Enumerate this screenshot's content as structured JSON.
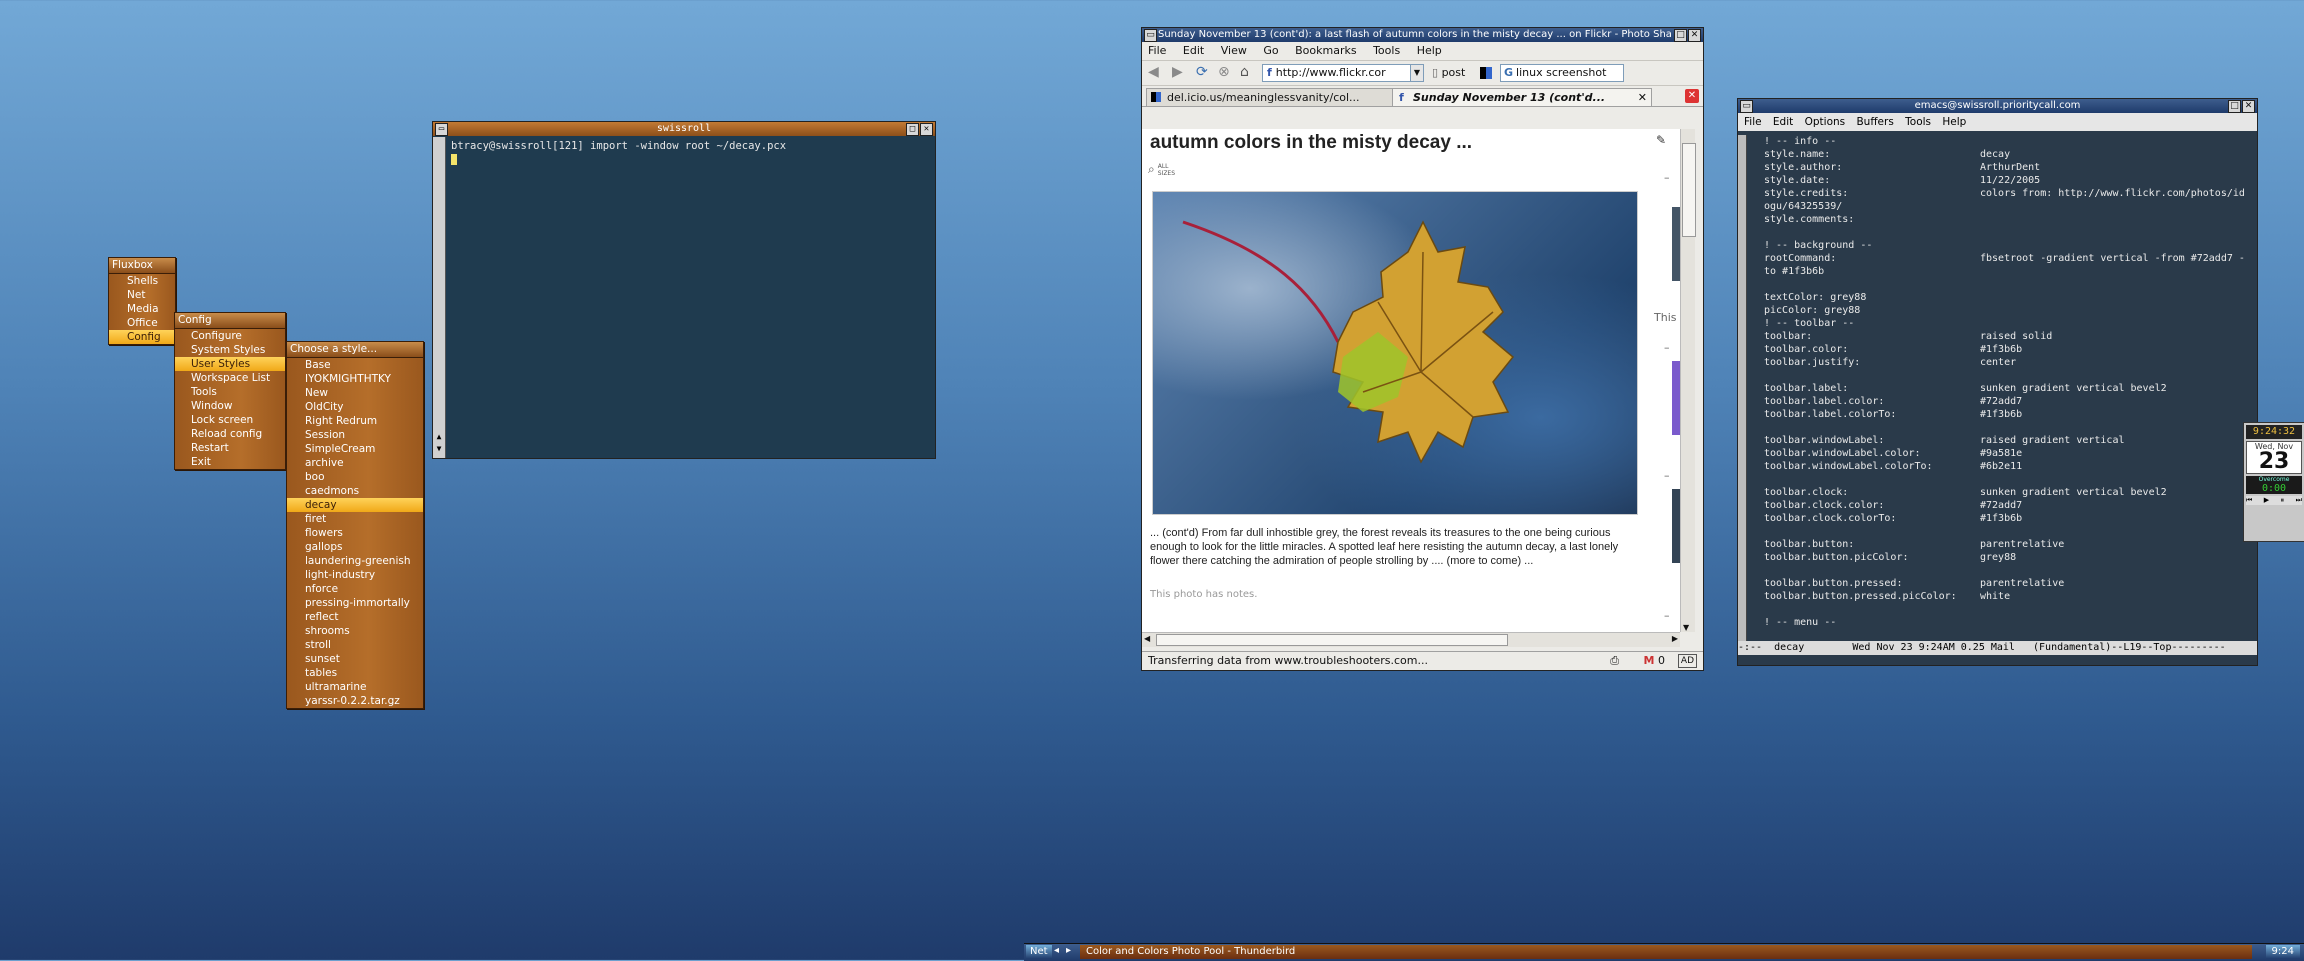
{
  "fluxbox_menu": {
    "title": "Fluxbox",
    "items": [
      "Shells",
      "Net",
      "Media",
      "Office",
      "Config"
    ]
  },
  "config_menu": {
    "title": "Config",
    "items": [
      "Configure",
      "System Styles",
      "User Styles",
      "Workspace List",
      "Tools",
      "Window",
      "Lock screen",
      "Reload config",
      "Restart",
      "Exit"
    ]
  },
  "style_menu": {
    "title": "Choose a style...",
    "items": [
      "Base",
      "IYOKMIGHTHTKY",
      "New",
      "OldCity",
      "Right Redrum",
      "Session",
      "SimpleCream",
      "archive",
      "boo",
      "caedmons",
      "decay",
      "firet",
      "flowers",
      "gallops",
      "laundering-greenish",
      "light-industry",
      "nforce",
      "pressing-immortally",
      "reflect",
      "shrooms",
      "stroll",
      "sunset",
      "tables",
      "ultramarine",
      "yarssr-0.2.2.tar.gz"
    ]
  },
  "terminal": {
    "title": "swissroll",
    "command_line": "btracy@swissroll[121] import -window root ~/decay.pcx"
  },
  "firefox": {
    "title": "Sunday November 13 (cont'd): a last flash of autumn colors in the misty decay ... on Flickr - Photo Sha",
    "menu": [
      "File",
      "Edit",
      "View",
      "Go",
      "Bookmarks",
      "Tools",
      "Help"
    ],
    "url": "http://www.flickr.cor",
    "bookmark_post": "post",
    "search_text": "linux screenshot",
    "tabs": [
      {
        "label": "del.icio.us/meaninglessvanity/col..."
      },
      {
        "label": "Sunday November 13 (cont'd..."
      }
    ],
    "page_heading": "autumn colors in the misty decay ...",
    "all_sizes": "ALL SIZES",
    "sidebar_fragment": "This",
    "description": "... (cont'd) From far dull inhostible grey, the forest reveals its treasures to the one being curious enough to look for the little miracles. A spotted leaf here resisting the autumn decay, a last lonely flower there catching the admiration of people strolling by .... (more to come) ...",
    "notes": "This photo has notes.",
    "status": "Transferring data from www.troubleshooters.com...",
    "mail_count": "0",
    "ad_badge": "AD"
  },
  "emacs": {
    "title": "emacs@swissroll.prioritycall.com",
    "menu": [
      "File",
      "Edit",
      "Options",
      "Buffers",
      "Tools",
      "Help"
    ],
    "lines": [
      {
        "k": "! -- info --",
        "v": ""
      },
      {
        "k": "style.name:",
        "v": "decay"
      },
      {
        "k": "style.author:",
        "v": "ArthurDent"
      },
      {
        "k": "style.date:",
        "v": "11/22/2005"
      },
      {
        "k": "style.credits:",
        "v": "colors from: http://www.flickr.com/photos/id"
      },
      {
        "k": "ogu/64325539/",
        "v": ""
      },
      {
        "k": "style.comments:",
        "v": ""
      },
      {
        "k": "",
        "v": ""
      },
      {
        "k": "! -- background --",
        "v": ""
      },
      {
        "k": "rootCommand:",
        "v": "fbsetroot -gradient vertical -from #72add7 -"
      },
      {
        "k": "to #1f3b6b",
        "v": ""
      },
      {
        "k": "",
        "v": ""
      },
      {
        "k": "textColor: grey88",
        "v": ""
      },
      {
        "k": "picColor: grey88",
        "v": ""
      },
      {
        "k": "! -- toolbar --",
        "v": ""
      },
      {
        "k": "toolbar:",
        "v": "raised solid"
      },
      {
        "k": "toolbar.color:",
        "v": "#1f3b6b"
      },
      {
        "k": "toolbar.justify:",
        "v": "center"
      },
      {
        "k": "",
        "v": ""
      },
      {
        "k": "toolbar.label:",
        "v": "sunken gradient vertical bevel2"
      },
      {
        "k": "toolbar.label.color:",
        "v": "#72add7"
      },
      {
        "k": "toolbar.label.colorTo:",
        "v": "#1f3b6b"
      },
      {
        "k": "",
        "v": ""
      },
      {
        "k": "toolbar.windowLabel:",
        "v": "raised gradient vertical"
      },
      {
        "k": "toolbar.windowLabel.color:",
        "v": "#9a581e"
      },
      {
        "k": "toolbar.windowLabel.colorTo:",
        "v": "#6b2e11"
      },
      {
        "k": "",
        "v": ""
      },
      {
        "k": "toolbar.clock:",
        "v": "sunken gradient vertical bevel2"
      },
      {
        "k": "toolbar.clock.color:",
        "v": "#72add7"
      },
      {
        "k": "toolbar.clock.colorTo:",
        "v": "#1f3b6b"
      },
      {
        "k": "",
        "v": ""
      },
      {
        "k": "toolbar.button:",
        "v": "parentrelative"
      },
      {
        "k": "toolbar.button.picColor:",
        "v": "grey88"
      },
      {
        "k": "",
        "v": ""
      },
      {
        "k": "toolbar.button.pressed:",
        "v": "parentrelative"
      },
      {
        "k": "toolbar.button.pressed.picColor:",
        "v": "white"
      },
      {
        "k": "",
        "v": ""
      },
      {
        "k": "! -- menu --",
        "v": ""
      }
    ],
    "modeline": "-:--  decay        Wed Nov 23 9:24AM 0.25 Mail   (Fundamental)--L19--Top---------"
  },
  "dockapp": {
    "time": "9:24:32",
    "weekday_month": "Wed, Nov",
    "day": "23",
    "timer_label": "Overcome",
    "timer": "0:00"
  },
  "toolbar": {
    "workspace": "Net",
    "window_label": "Color and Colors Photo Pool - Thunderbird",
    "clock": "9:24"
  },
  "colors": {
    "menu_orange": "#9a581e",
    "highlight": "#f0a818",
    "desktop_top": "#72add7",
    "desktop_bottom": "#1f3b6b"
  }
}
